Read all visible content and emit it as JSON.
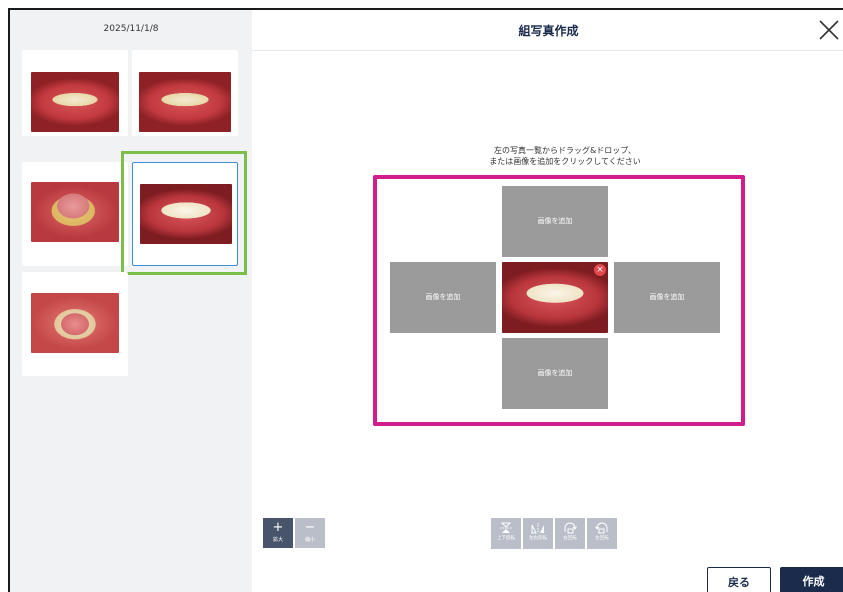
{
  "dialog": {
    "title": "組写真作成",
    "close_icon": "close-icon"
  },
  "sidebar": {
    "date": "2025/11/1/8",
    "thumbnails": [
      {
        "view": "frontal-bite",
        "selected": false
      },
      {
        "view": "frontal-bite",
        "selected": false
      },
      {
        "view": "lower-occlusal",
        "selected": false
      },
      {
        "view": "frontal-bite",
        "selected": true
      },
      {
        "view": "upper-occlusal",
        "selected": false
      }
    ]
  },
  "instruction": {
    "line1": "左の写真一覧からドラッグ&ドロップ、",
    "line2": "または画像を追加をクリックしてください"
  },
  "layout_slots": {
    "top": "画像を追加",
    "left": "画像を追加",
    "right": "画像を追加",
    "bottom": "画像を追加",
    "center": "frontal-bite",
    "remove_symbol": "×"
  },
  "zoom": {
    "in_symbol": "+",
    "in_label": "拡大",
    "out_symbol": "−",
    "out_label": "縮小"
  },
  "tools": [
    {
      "label": "上下反転",
      "icon": "flip-vertical-icon"
    },
    {
      "label": "左右反転",
      "icon": "flip-horizontal-icon"
    },
    {
      "label": "右回転",
      "icon": "rotate-right-icon"
    },
    {
      "label": "左回転",
      "icon": "rotate-left-icon"
    }
  ],
  "footer": {
    "back_label": "戻る",
    "create_label": "作成"
  },
  "colors": {
    "primary": "#1a2b4c",
    "highlight_magenta": "#d11d8c",
    "highlight_green": "#7bbf4a",
    "selected_blue": "#3d8fd6",
    "slot_gray": "#9b9b9b"
  }
}
